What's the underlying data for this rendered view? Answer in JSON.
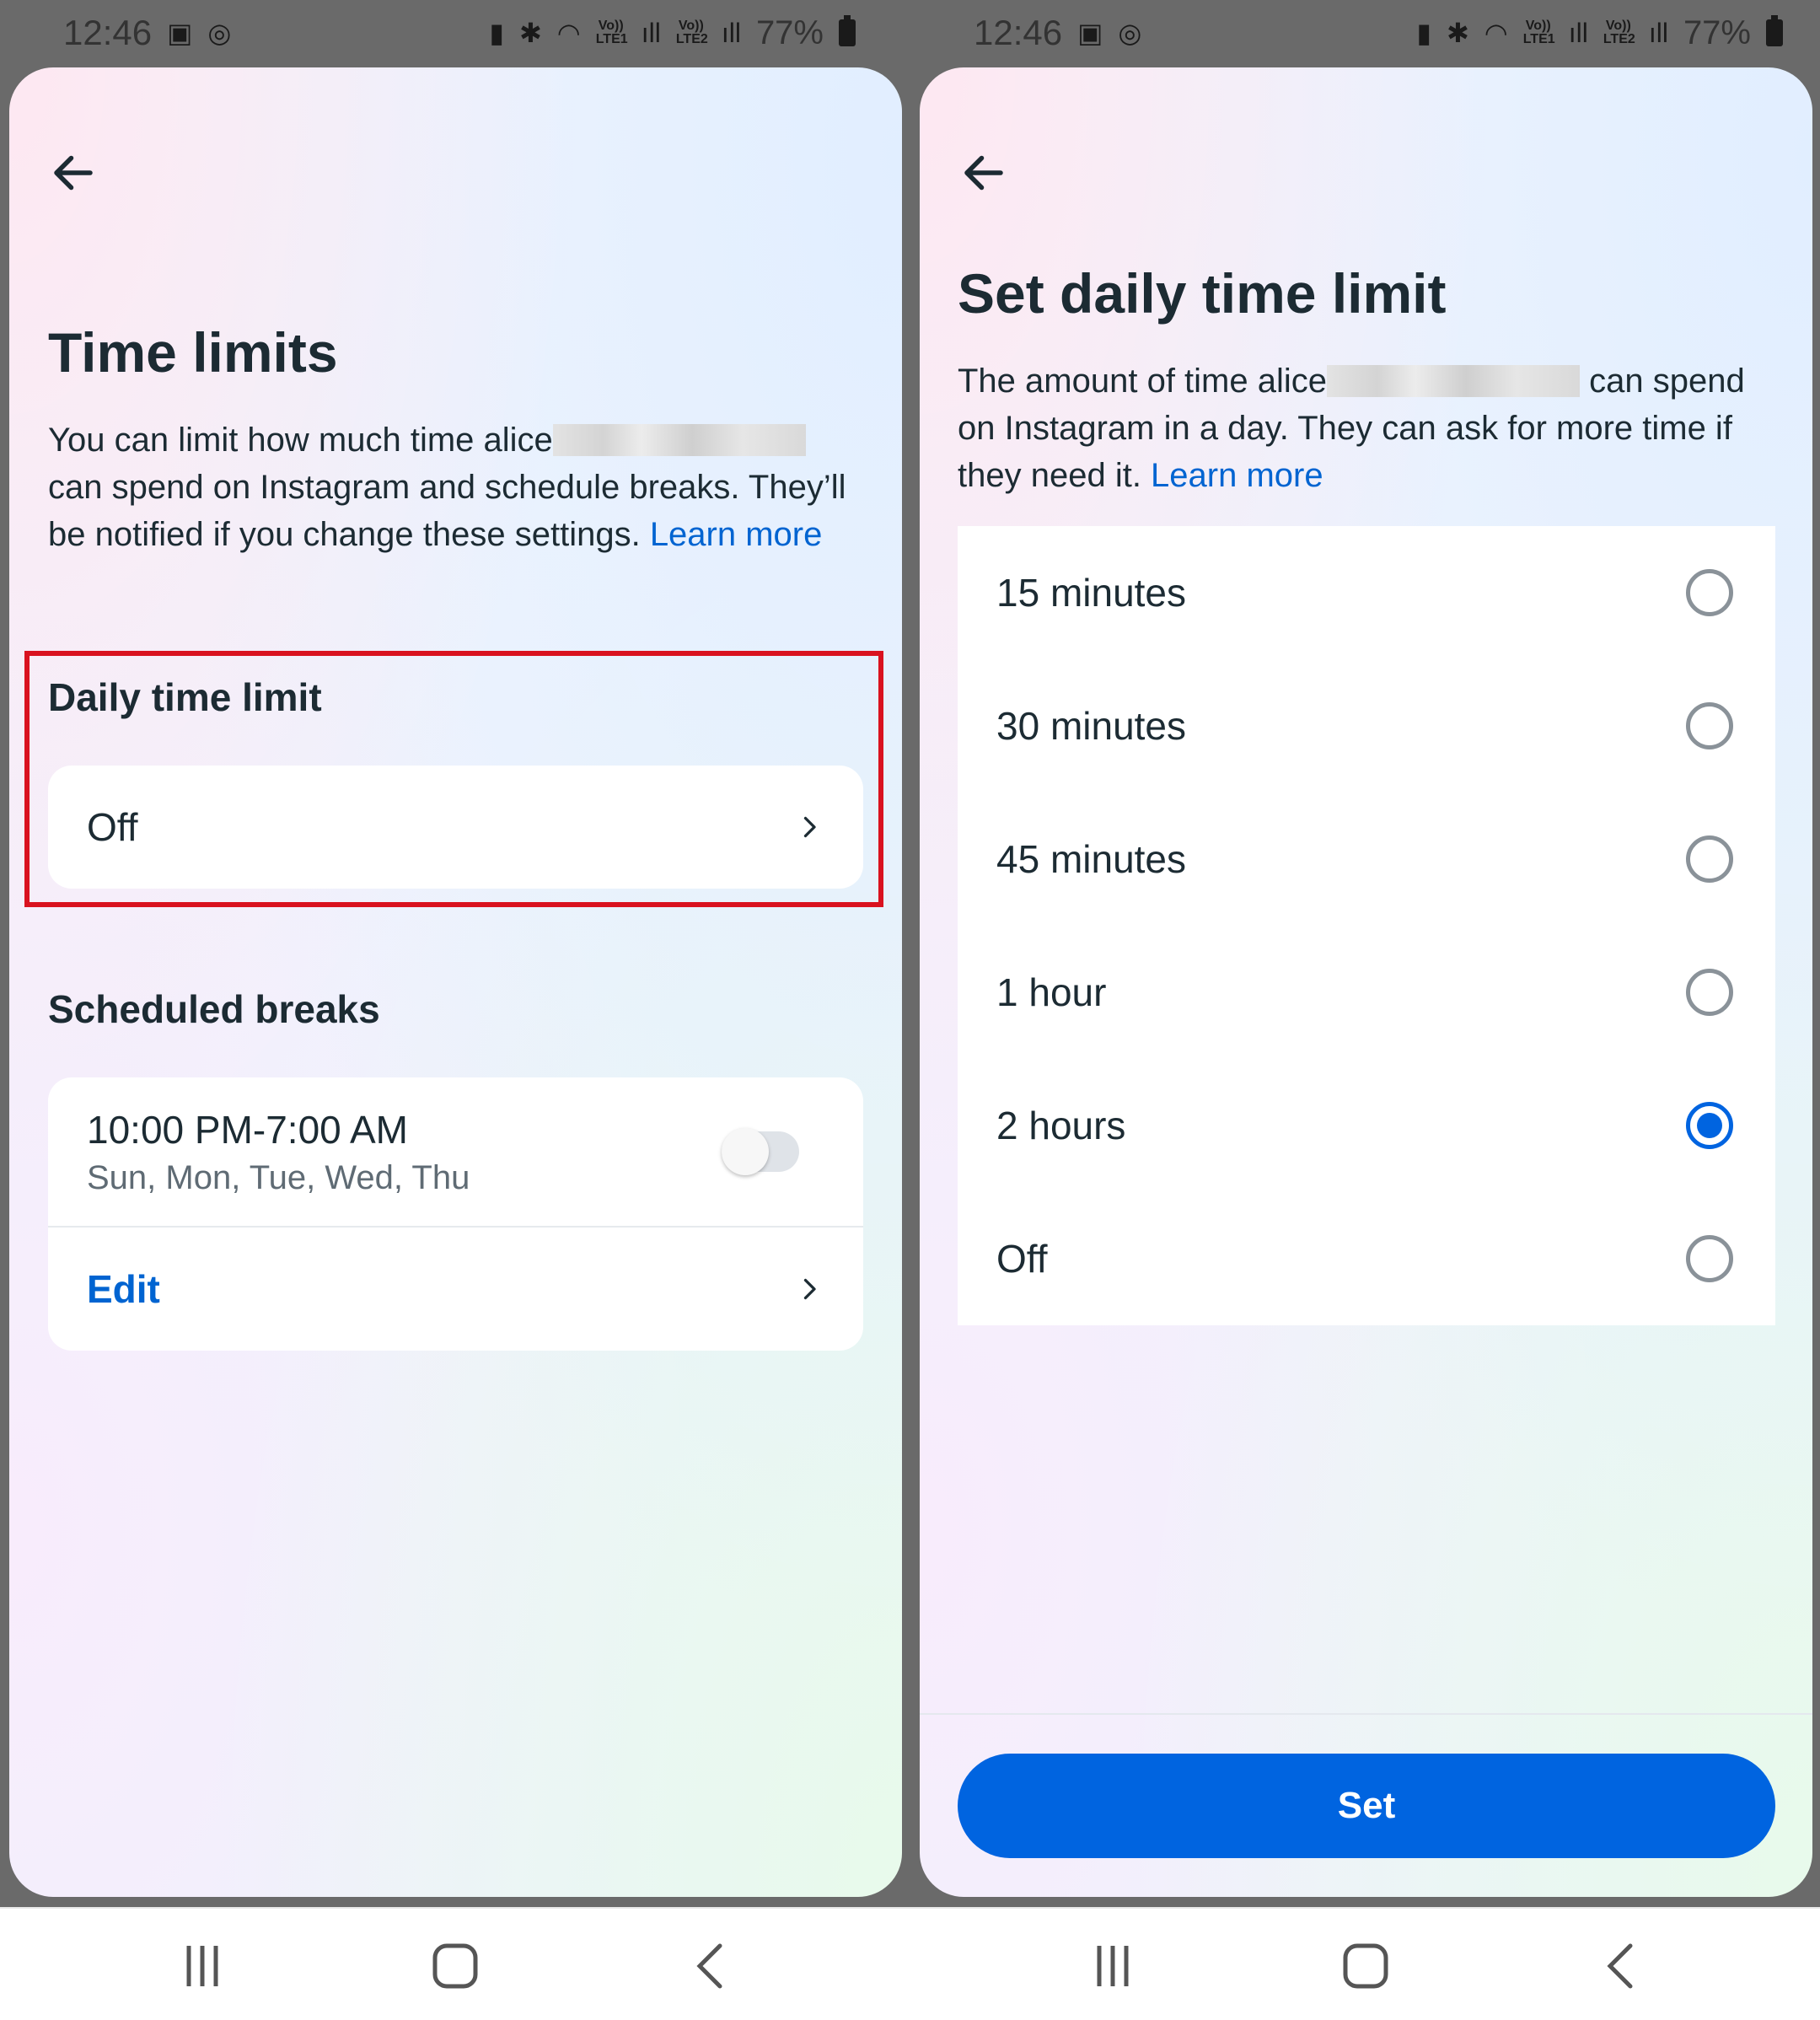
{
  "status_left": {
    "time": "12:46"
  },
  "status_right": {
    "battery": "77%",
    "sim1": "Vo)) LTE1",
    "sim2": "Vo)) LTE2"
  },
  "left_screen": {
    "title": "Time limits",
    "desc_pre": "You can limit how much time alice",
    "desc_post": " can spend on Instagram and schedule breaks. They’ll be notified if you change these settings. ",
    "learn_more": "Learn more",
    "daily_label": "Daily time limit",
    "daily_value": "Off",
    "breaks_label": "Scheduled breaks",
    "break_time": "10:00 PM-7:00 AM",
    "break_days": "Sun, Mon, Tue, Wed, Thu",
    "break_enabled": false,
    "edit_label": "Edit"
  },
  "right_screen": {
    "title": "Set daily time limit",
    "desc_pre": "The amount of time alice",
    "desc_post": " can spend on Instagram in a day. They can ask for more time if they need it. ",
    "learn_more": "Learn more",
    "options": [
      {
        "label": "15 minutes",
        "selected": false
      },
      {
        "label": "30 minutes",
        "selected": false
      },
      {
        "label": "45 minutes",
        "selected": false
      },
      {
        "label": "1 hour",
        "selected": false
      },
      {
        "label": "2 hours",
        "selected": true
      },
      {
        "label": "Off",
        "selected": false
      }
    ],
    "set_label": "Set"
  },
  "colors": {
    "accent": "#0064e0",
    "link": "#0064d1",
    "highlight": "#d9121f"
  }
}
